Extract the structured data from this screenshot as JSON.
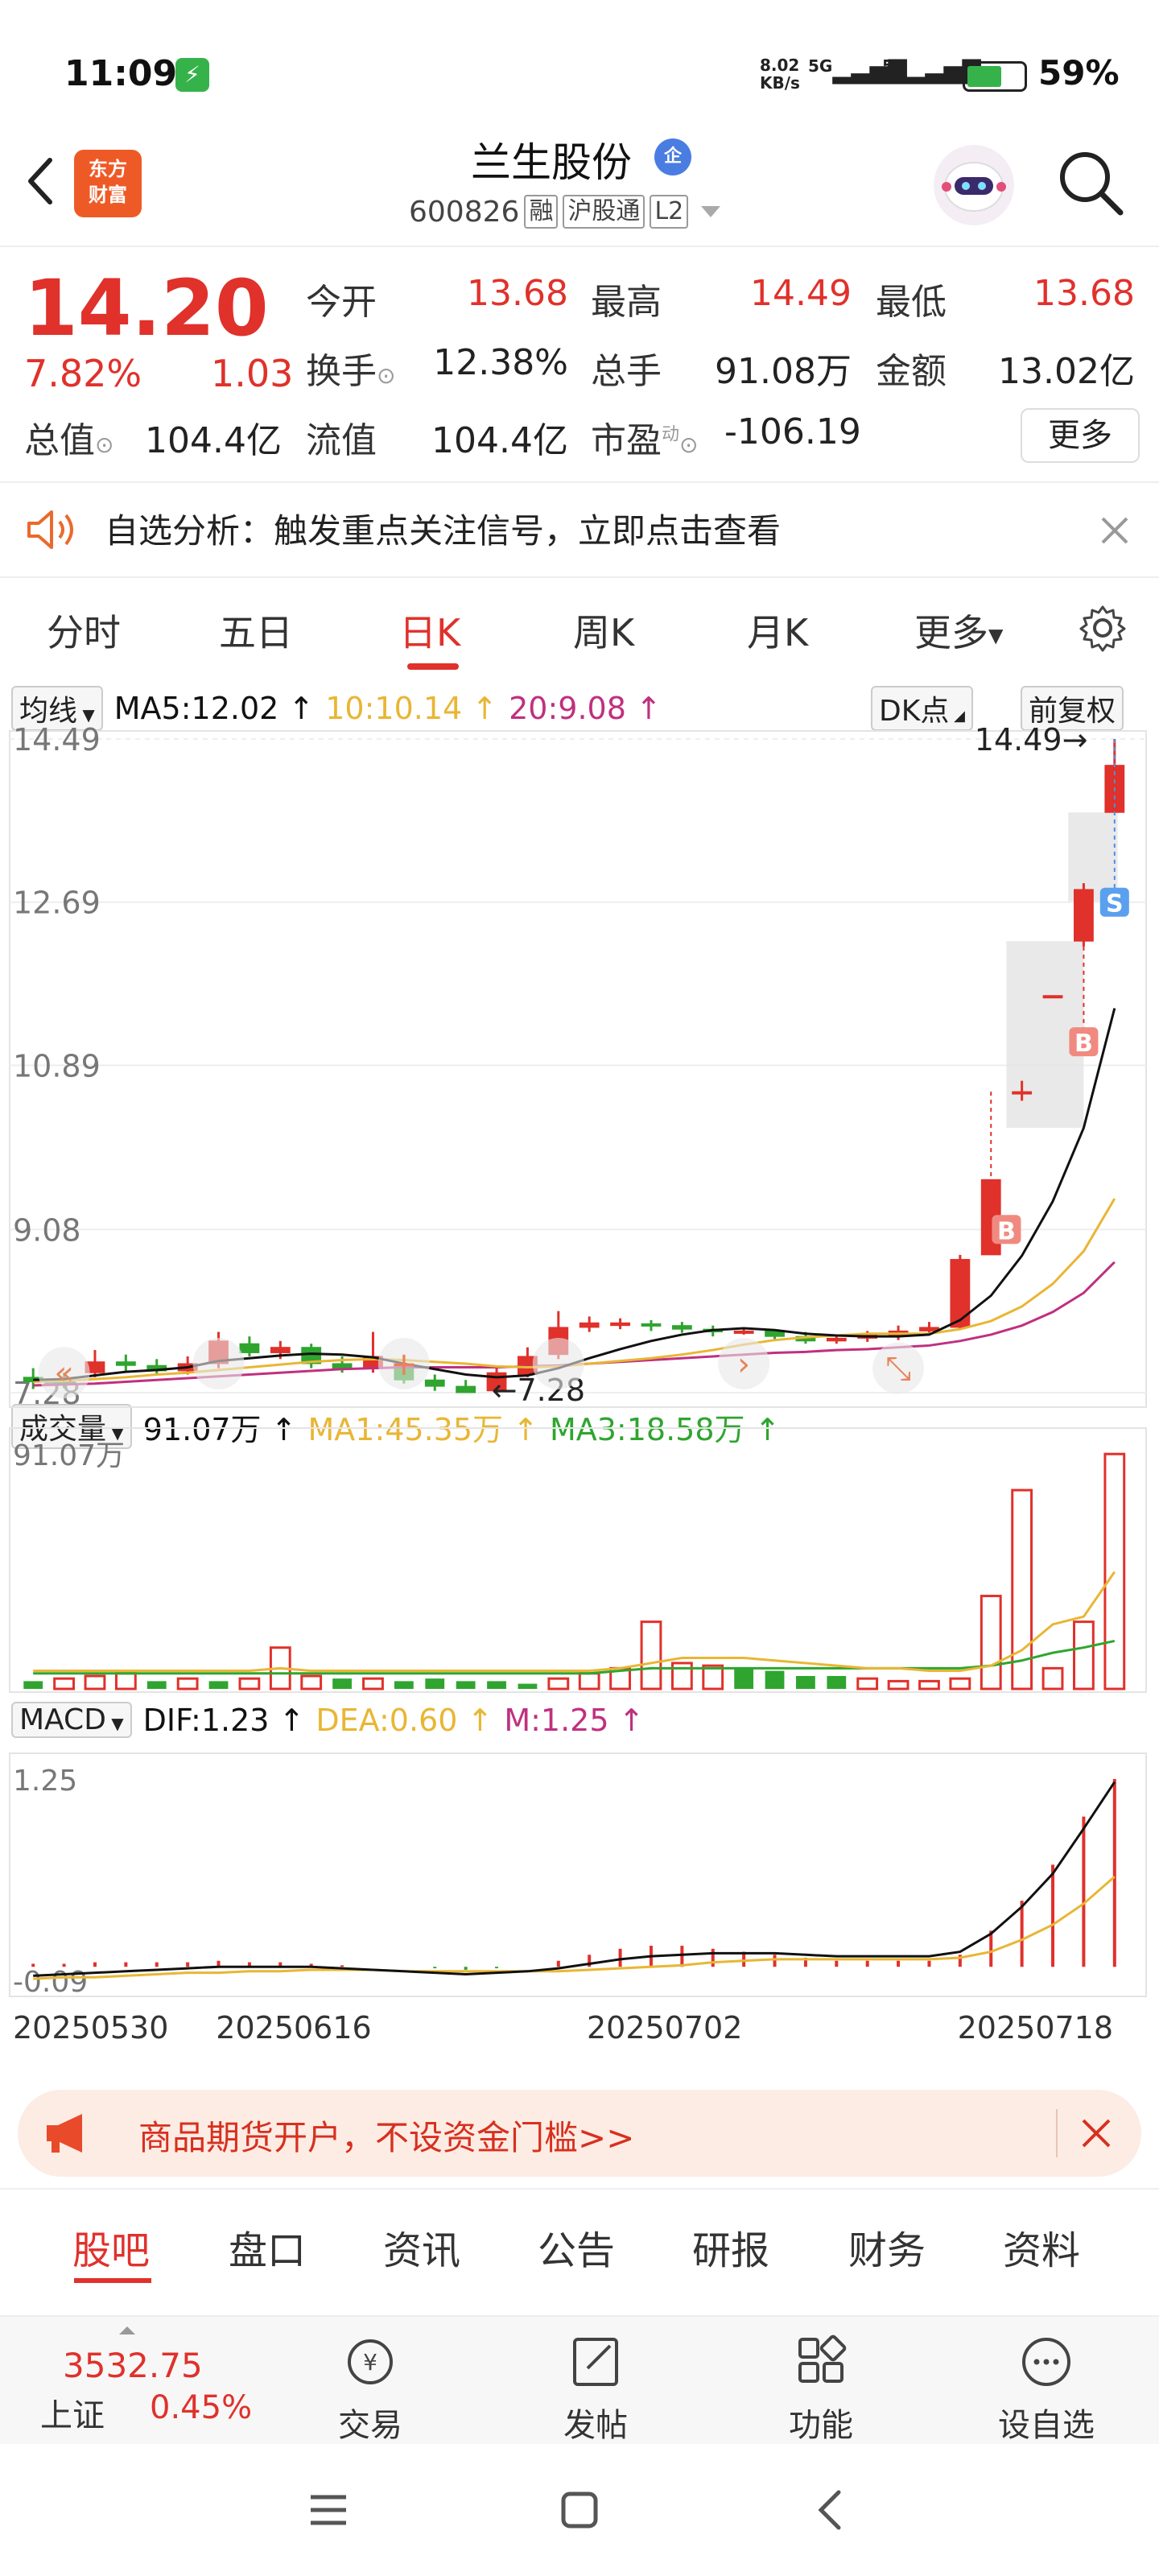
{
  "status_bar": {
    "time": "11:09",
    "net_speed_top": "8.02",
    "net_speed_bottom": "KB/s",
    "signal1": "5G",
    "signal2": "5G",
    "battery": "59%"
  },
  "header": {
    "logo_line1": "东方",
    "logo_line2": "财富",
    "stock_name": "兰生股份",
    "cert_badge": "企",
    "code": "600826",
    "tags": [
      "融",
      "沪股通",
      "L2"
    ]
  },
  "quote": {
    "price": "14.20",
    "change_pct": "7.82%",
    "change_abs": "1.03",
    "rows": [
      [
        {
          "label": "今开",
          "value": "13.68",
          "red": true
        },
        {
          "label": "最高",
          "value": "14.49",
          "red": true
        },
        {
          "label": "最低",
          "value": "13.68",
          "red": true
        }
      ],
      [
        {
          "label": "换手",
          "value": "12.38%",
          "red": false
        },
        {
          "label": "总手",
          "value": "91.08万",
          "red": false
        },
        {
          "label": "金额",
          "value": "13.02亿",
          "red": false
        }
      ]
    ],
    "total_cap_label": "总值",
    "total_cap": "104.4亿",
    "float_cap_label": "流值",
    "float_cap": "104.4亿",
    "pe_label": "市盈",
    "pe_sup": "动",
    "pe": "-106.19",
    "more": "更多"
  },
  "alert": {
    "text": "自选分析：触发重点关注信号，立即点击查看"
  },
  "tabs": [
    "分时",
    "五日",
    "日K",
    "周K",
    "月K",
    "更多"
  ],
  "active_tab": "日K",
  "kline_legend": {
    "selector": "均线",
    "ma5": "MA5:12.02",
    "ma10": "10:10.14",
    "ma20": "20:9.08",
    "dk": "DK点",
    "adjust": "前复权"
  },
  "volume_legend": {
    "selector": "成交量",
    "vol": "91.07万",
    "ma1": "MA1:45.35万",
    "ma3": "MA3:18.58万"
  },
  "macd_legend": {
    "selector": "MACD",
    "dif": "DIF:1.23",
    "dea": "DEA:0.60",
    "m": "M:1.25"
  },
  "chart_data": [
    {
      "type": "candlestick",
      "y_ticks": [
        "14.49",
        "12.69",
        "10.89",
        "9.08",
        "7.28"
      ],
      "ylim": [
        7.28,
        14.49
      ],
      "high_label": "14.49",
      "low_label": "7.28",
      "candles": [
        {
          "o": 7.45,
          "c": 7.4,
          "h": 7.55,
          "l": 7.32
        },
        {
          "o": 7.42,
          "c": 7.38,
          "h": 7.5,
          "l": 7.33
        },
        {
          "o": 7.5,
          "c": 7.62,
          "h": 7.75,
          "l": 7.45
        },
        {
          "o": 7.62,
          "c": 7.58,
          "h": 7.7,
          "l": 7.5
        },
        {
          "o": 7.58,
          "c": 7.52,
          "h": 7.65,
          "l": 7.48
        },
        {
          "o": 7.52,
          "c": 7.6,
          "h": 7.68,
          "l": 7.48
        },
        {
          "o": 7.6,
          "c": 7.85,
          "h": 7.95,
          "l": 7.55
        },
        {
          "o": 7.82,
          "c": 7.72,
          "h": 7.9,
          "l": 7.68
        },
        {
          "o": 7.72,
          "c": 7.78,
          "h": 7.85,
          "l": 7.65
        },
        {
          "o": 7.78,
          "c": 7.6,
          "h": 7.82,
          "l": 7.55
        },
        {
          "o": 7.6,
          "c": 7.55,
          "h": 7.68,
          "l": 7.5
        },
        {
          "o": 7.55,
          "c": 7.68,
          "h": 7.95,
          "l": 7.5
        },
        {
          "o": 7.58,
          "c": 7.42,
          "h": 7.62,
          "l": 7.38
        },
        {
          "o": 7.42,
          "c": 7.35,
          "h": 7.48,
          "l": 7.3
        },
        {
          "o": 7.35,
          "c": 7.28,
          "h": 7.42,
          "l": 7.28
        },
        {
          "o": 7.3,
          "c": 7.5,
          "h": 7.58,
          "l": 7.28
        },
        {
          "o": 7.48,
          "c": 7.68,
          "h": 7.78,
          "l": 7.45
        },
        {
          "o": 7.7,
          "c": 8.0,
          "h": 8.18,
          "l": 7.65
        },
        {
          "o": 8.0,
          "c": 8.05,
          "h": 8.12,
          "l": 7.95
        },
        {
          "o": 8.02,
          "c": 8.05,
          "h": 8.1,
          "l": 7.98
        },
        {
          "o": 8.04,
          "c": 8.02,
          "h": 8.08,
          "l": 7.96
        },
        {
          "o": 8.02,
          "c": 7.98,
          "h": 8.06,
          "l": 7.94
        },
        {
          "o": 7.98,
          "c": 7.95,
          "h": 8.02,
          "l": 7.9
        },
        {
          "o": 7.95,
          "c": 7.96,
          "h": 8.0,
          "l": 7.92
        },
        {
          "o": 7.96,
          "c": 7.9,
          "h": 7.98,
          "l": 7.86
        },
        {
          "o": 7.9,
          "c": 7.85,
          "h": 7.95,
          "l": 7.82
        },
        {
          "o": 7.85,
          "c": 7.88,
          "h": 7.92,
          "l": 7.82
        },
        {
          "o": 7.88,
          "c": 7.92,
          "h": 7.96,
          "l": 7.84
        },
        {
          "o": 7.9,
          "c": 7.96,
          "h": 8.02,
          "l": 7.86
        },
        {
          "o": 7.96,
          "c": 8.0,
          "h": 8.06,
          "l": 7.92
        },
        {
          "o": 8.0,
          "c": 8.75,
          "h": 8.8,
          "l": 7.98
        },
        {
          "o": 8.8,
          "c": 9.63,
          "h": 9.63,
          "l": 8.8
        },
        {
          "o": 10.6,
          "c": 10.6,
          "h": 10.72,
          "l": 10.5
        },
        {
          "o": 11.66,
          "c": 11.66,
          "h": 11.66,
          "l": 11.66
        },
        {
          "o": 12.26,
          "c": 12.83,
          "h": 12.9,
          "l": 12.2
        },
        {
          "o": 13.68,
          "c": 14.2,
          "h": 14.49,
          "l": 13.68
        }
      ],
      "ma5": [
        7.42,
        7.43,
        7.47,
        7.51,
        7.53,
        7.56,
        7.63,
        7.66,
        7.69,
        7.71,
        7.7,
        7.67,
        7.6,
        7.54,
        7.48,
        7.45,
        7.47,
        7.55,
        7.66,
        7.76,
        7.85,
        7.92,
        7.97,
        7.99,
        7.97,
        7.93,
        7.91,
        7.9,
        7.9,
        7.92,
        8.08,
        8.35,
        8.79,
        9.39,
        10.2,
        11.52
      ],
      "ma10": [
        7.4,
        7.41,
        7.43,
        7.45,
        7.48,
        7.5,
        7.53,
        7.56,
        7.59,
        7.62,
        7.64,
        7.65,
        7.64,
        7.62,
        7.6,
        7.57,
        7.56,
        7.57,
        7.6,
        7.63,
        7.66,
        7.7,
        7.75,
        7.81,
        7.86,
        7.89,
        7.91,
        7.93,
        7.93,
        7.93,
        7.98,
        8.07,
        8.23,
        8.48,
        8.84,
        9.42
      ],
      "ma20": [
        7.36,
        7.37,
        7.38,
        7.4,
        7.42,
        7.44,
        7.46,
        7.48,
        7.5,
        7.52,
        7.54,
        7.55,
        7.56,
        7.56,
        7.56,
        7.56,
        7.57,
        7.58,
        7.6,
        7.62,
        7.64,
        7.66,
        7.68,
        7.7,
        7.72,
        7.73,
        7.75,
        7.76,
        7.78,
        7.8,
        7.85,
        7.92,
        8.02,
        8.17,
        8.38,
        8.72
      ]
    },
    {
      "type": "bar",
      "title": "成交量",
      "y_tick": "91.07万",
      "ylim": [
        0,
        91.07
      ],
      "values": [
        3,
        4,
        5,
        6,
        3,
        4,
        3,
        4,
        16,
        5,
        4,
        4,
        3,
        4,
        3,
        3,
        2,
        4,
        6,
        8,
        26,
        10,
        9,
        8,
        7,
        5,
        5,
        4,
        3,
        3,
        4,
        36,
        77,
        8,
        26,
        91
      ],
      "up": [
        0,
        1,
        1,
        1,
        0,
        1,
        0,
        1,
        1,
        1,
        0,
        1,
        0,
        0,
        0,
        0,
        0,
        1,
        1,
        1,
        1,
        1,
        1,
        0,
        0,
        0,
        0,
        1,
        1,
        1,
        1,
        1,
        1,
        1,
        1,
        1
      ],
      "ma1": [
        7,
        7,
        7,
        7,
        7,
        7,
        7,
        7,
        8,
        7,
        7,
        7,
        7,
        7,
        7,
        7,
        7,
        7,
        7,
        8,
        10,
        12,
        12,
        12,
        11,
        10,
        9,
        8,
        8,
        7,
        7,
        9,
        15,
        25,
        28,
        45.35
      ],
      "ma3": [
        6,
        6,
        6,
        6,
        6,
        6,
        6,
        6,
        6,
        6,
        6,
        6,
        6,
        6,
        6,
        6,
        6,
        6,
        6,
        7,
        8,
        8,
        8,
        8,
        8,
        8,
        8,
        8,
        8,
        8,
        8,
        9,
        11,
        14,
        16,
        18.58
      ]
    },
    {
      "type": "macd",
      "y_ticks": [
        "1.25",
        "-0.09"
      ],
      "ylim": [
        -0.09,
        1.25
      ],
      "x_labels": [
        "20250530",
        "20250616",
        "20250702",
        "20250718"
      ],
      "x_label_index": [
        0,
        8,
        20,
        32
      ],
      "dif": [
        -0.06,
        -0.05,
        -0.04,
        -0.03,
        -0.02,
        -0.01,
        0.0,
        0.0,
        0.0,
        0.0,
        -0.01,
        -0.02,
        -0.03,
        -0.04,
        -0.05,
        -0.04,
        -0.03,
        -0.01,
        0.02,
        0.05,
        0.07,
        0.08,
        0.09,
        0.09,
        0.09,
        0.08,
        0.07,
        0.07,
        0.07,
        0.07,
        0.1,
        0.22,
        0.4,
        0.62,
        0.92,
        1.23
      ],
      "dea": [
        -0.08,
        -0.07,
        -0.07,
        -0.06,
        -0.05,
        -0.04,
        -0.04,
        -0.03,
        -0.03,
        -0.02,
        -0.02,
        -0.02,
        -0.03,
        -0.03,
        -0.03,
        -0.03,
        -0.03,
        -0.03,
        -0.02,
        -0.01,
        0.0,
        0.01,
        0.03,
        0.04,
        0.05,
        0.05,
        0.05,
        0.05,
        0.05,
        0.05,
        0.06,
        0.1,
        0.18,
        0.28,
        0.42,
        0.6
      ],
      "hist": [
        0.02,
        0.02,
        0.03,
        0.03,
        0.03,
        0.03,
        0.04,
        0.03,
        0.03,
        0.02,
        0.01,
        0.0,
        0.0,
        -0.01,
        -0.02,
        -0.01,
        0.0,
        0.04,
        0.08,
        0.12,
        0.14,
        0.14,
        0.12,
        0.1,
        0.08,
        0.06,
        0.04,
        0.04,
        0.04,
        0.04,
        0.08,
        0.24,
        0.44,
        0.68,
        1.0,
        1.25
      ]
    }
  ],
  "ad_banner": {
    "text": "商品期货开户，不设资金门槛>>"
  },
  "sub_tabs": [
    "股吧",
    "盘口",
    "资讯",
    "公告",
    "研报",
    "财务",
    "资料"
  ],
  "bottom_bar": {
    "index_value": "3532.75",
    "index_name": "上证",
    "index_pct": "0.45%",
    "items": [
      "交易",
      "发帖",
      "功能",
      "设自选"
    ]
  },
  "colors": {
    "up": "#e0312b",
    "down": "#2fa52f",
    "ma5": "#111111",
    "ma10": "#e9b634",
    "ma20": "#c0307f",
    "dif": "#111111",
    "dea": "#e9b634"
  },
  "markers": {
    "buy": "B",
    "sell": "S"
  }
}
